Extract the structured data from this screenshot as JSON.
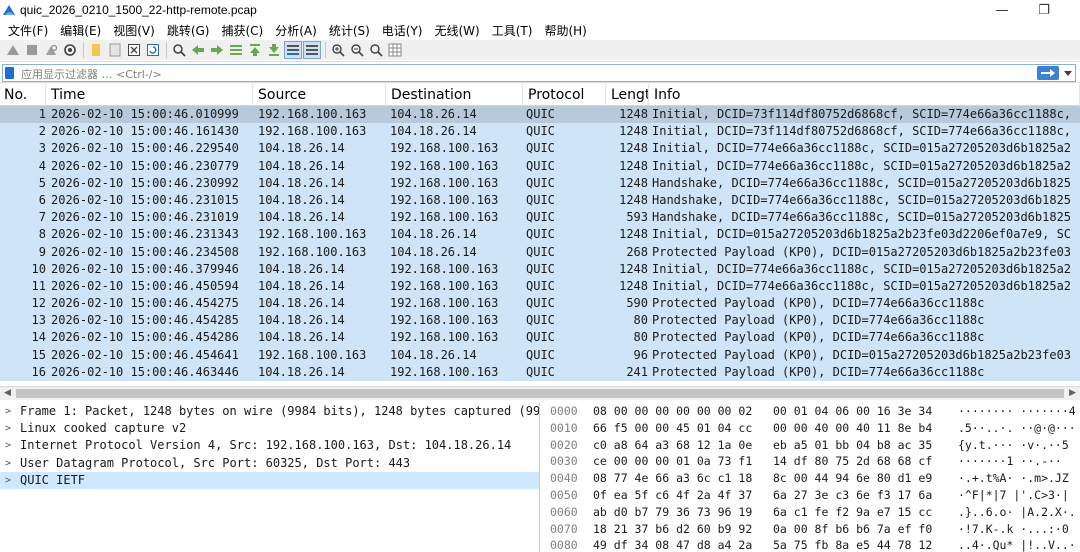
{
  "window": {
    "title": "quic_2026_0210_1500_22-http-remote.pcap",
    "minimize_glyph": "—",
    "restore_glyph": "❐"
  },
  "menu": [
    "文件(F)",
    "编辑(E)",
    "视图(V)",
    "跳转(G)",
    "捕获(C)",
    "分析(A)",
    "统计(S)",
    "电话(Y)",
    "无线(W)",
    "工具(T)",
    "帮助(H)"
  ],
  "toolbar_icons": [
    "shark-fin-start-icon",
    "stop-capture-icon",
    "restart-capture-icon",
    "capture-options-icon",
    "open-file-icon",
    "save-file-icon",
    "close-file-icon",
    "reload-file-icon",
    "find-packet-icon",
    "go-back-icon",
    "go-forward-icon",
    "go-to-packet-icon",
    "go-first-icon",
    "go-last-icon",
    "autoscroll-icon",
    "colorize-icon",
    "zoom-in-icon",
    "zoom-out-icon",
    "zoom-normal-icon",
    "resize-columns-icon"
  ],
  "filter": {
    "placeholder": "应用显示过滤器 … <Ctrl-/>"
  },
  "packet_list": {
    "columns": [
      "No.",
      "Time",
      "Source",
      "Destination",
      "Protocol",
      "Lengt",
      "Info"
    ],
    "rows": [
      {
        "no": "1",
        "time": "2026-02-10 15:00:46.010999",
        "src": "192.168.100.163",
        "dst": "104.18.26.14",
        "proto": "QUIC",
        "len": "1248",
        "info": "Initial, DCID=73f114df80752d6868cf, SCID=774e66a36cc1188c,"
      },
      {
        "no": "2",
        "time": "2026-02-10 15:00:46.161430",
        "src": "192.168.100.163",
        "dst": "104.18.26.14",
        "proto": "QUIC",
        "len": "1248",
        "info": "Initial, DCID=73f114df80752d6868cf, SCID=774e66a36cc1188c,"
      },
      {
        "no": "3",
        "time": "2026-02-10 15:00:46.229540",
        "src": "104.18.26.14",
        "dst": "192.168.100.163",
        "proto": "QUIC",
        "len": "1248",
        "info": "Initial, DCID=774e66a36cc1188c, SCID=015a27205203d6b1825a2"
      },
      {
        "no": "4",
        "time": "2026-02-10 15:00:46.230779",
        "src": "104.18.26.14",
        "dst": "192.168.100.163",
        "proto": "QUIC",
        "len": "1248",
        "info": "Initial, DCID=774e66a36cc1188c, SCID=015a27205203d6b1825a2"
      },
      {
        "no": "5",
        "time": "2026-02-10 15:00:46.230992",
        "src": "104.18.26.14",
        "dst": "192.168.100.163",
        "proto": "QUIC",
        "len": "1248",
        "info": "Handshake, DCID=774e66a36cc1188c, SCID=015a27205203d6b1825"
      },
      {
        "no": "6",
        "time": "2026-02-10 15:00:46.231015",
        "src": "104.18.26.14",
        "dst": "192.168.100.163",
        "proto": "QUIC",
        "len": "1248",
        "info": "Handshake, DCID=774e66a36cc1188c, SCID=015a27205203d6b1825"
      },
      {
        "no": "7",
        "time": "2026-02-10 15:00:46.231019",
        "src": "104.18.26.14",
        "dst": "192.168.100.163",
        "proto": "QUIC",
        "len": "593",
        "info": "Handshake, DCID=774e66a36cc1188c, SCID=015a27205203d6b1825"
      },
      {
        "no": "8",
        "time": "2026-02-10 15:00:46.231343",
        "src": "192.168.100.163",
        "dst": "104.18.26.14",
        "proto": "QUIC",
        "len": "1248",
        "info": "Initial, DCID=015a27205203d6b1825a2b23fe03d2206ef0a7e9, SC"
      },
      {
        "no": "9",
        "time": "2026-02-10 15:00:46.234508",
        "src": "192.168.100.163",
        "dst": "104.18.26.14",
        "proto": "QUIC",
        "len": "268",
        "info": "Protected Payload (KP0), DCID=015a27205203d6b1825a2b23fe03"
      },
      {
        "no": "10",
        "time": "2026-02-10 15:00:46.379946",
        "src": "104.18.26.14",
        "dst": "192.168.100.163",
        "proto": "QUIC",
        "len": "1248",
        "info": "Initial, DCID=774e66a36cc1188c, SCID=015a27205203d6b1825a2"
      },
      {
        "no": "11",
        "time": "2026-02-10 15:00:46.450594",
        "src": "104.18.26.14",
        "dst": "192.168.100.163",
        "proto": "QUIC",
        "len": "1248",
        "info": "Initial, DCID=774e66a36cc1188c, SCID=015a27205203d6b1825a2"
      },
      {
        "no": "12",
        "time": "2026-02-10 15:00:46.454275",
        "src": "104.18.26.14",
        "dst": "192.168.100.163",
        "proto": "QUIC",
        "len": "590",
        "info": "Protected Payload (KP0), DCID=774e66a36cc1188c"
      },
      {
        "no": "13",
        "time": "2026-02-10 15:00:46.454285",
        "src": "104.18.26.14",
        "dst": "192.168.100.163",
        "proto": "QUIC",
        "len": "80",
        "info": "Protected Payload (KP0), DCID=774e66a36cc1188c"
      },
      {
        "no": "14",
        "time": "2026-02-10 15:00:46.454286",
        "src": "104.18.26.14",
        "dst": "192.168.100.163",
        "proto": "QUIC",
        "len": "80",
        "info": "Protected Payload (KP0), DCID=774e66a36cc1188c"
      },
      {
        "no": "15",
        "time": "2026-02-10 15:00:46.454641",
        "src": "192.168.100.163",
        "dst": "104.18.26.14",
        "proto": "QUIC",
        "len": "96",
        "info": "Protected Payload (KP0), DCID=015a27205203d6b1825a2b23fe03"
      },
      {
        "no": "16",
        "time": "2026-02-10 15:00:46.463446",
        "src": "104.18.26.14",
        "dst": "192.168.100.163",
        "proto": "QUIC",
        "len": "241",
        "info": "Protected Payload (KP0), DCID=774e66a36cc1188c"
      }
    ]
  },
  "details": [
    {
      "text": "Frame 1: Packet, 1248 bytes on wire (9984 bits), 1248 bytes captured (998",
      "selected": false
    },
    {
      "text": "Linux cooked capture v2",
      "selected": false
    },
    {
      "text": "Internet Protocol Version 4, Src: 192.168.100.163, Dst: 104.18.26.14",
      "selected": false
    },
    {
      "text": "User Datagram Protocol, Src Port: 60325, Dst Port: 443",
      "selected": false
    },
    {
      "text": "QUIC IETF",
      "selected": true
    }
  ],
  "bytes": [
    {
      "off": "0000",
      "hex": "08 00 00 00 00 00 00 02   00 01 04 06 00 16 3e 34",
      "ascii": "········ ·······4"
    },
    {
      "off": "0010",
      "hex": "66 f5 00 00 45 01 04 cc   00 00 40 00 40 11 8e b4",
      "ascii": ".5··..·. ··@·@···"
    },
    {
      "off": "0020",
      "hex": "c0 a8 64 a3 68 12 1a 0e   eb a5 01 bb 04 b8 ac 35",
      "ascii": "{y.t.··· ·v·.··5"
    },
    {
      "off": "0030",
      "hex": "ce 00 00 00 01 0a 73 f1   14 df 80 75 2d 68 68 cf",
      "ascii": "·······1 ··.-··"
    },
    {
      "off": "0040",
      "hex": "08 77 4e 66 a3 6c c1 18   8c 00 44 94 6e 80 d1 e9",
      "ascii": "·.+.t%A· ·.m>.JZ"
    },
    {
      "off": "0050",
      "hex": "0f ea 5f c6 4f 2a 4f 37   6a 27 3e c3 6e f3 17 6a",
      "ascii": "·^F|*|7 |'.C>3·|"
    },
    {
      "off": "0060",
      "hex": "ab d0 b7 79 36 73 96 19   6a c1 fe f2 9a e7 15 cc",
      "ascii": ".}..6.o· |A.2.X·."
    },
    {
      "off": "0070",
      "hex": "18 21 37 b6 d2 60 b9 92   0a 00 8f b6 b6 7a ef f0",
      "ascii": "·!7.K-.k ·...:·0"
    },
    {
      "off": "0080",
      "hex": "49 df 34 08 47 d8 a4 2a   5a 75 fb 8a e5 44 78 12",
      "ascii": "..4·.Qu* |!..V..·"
    }
  ]
}
